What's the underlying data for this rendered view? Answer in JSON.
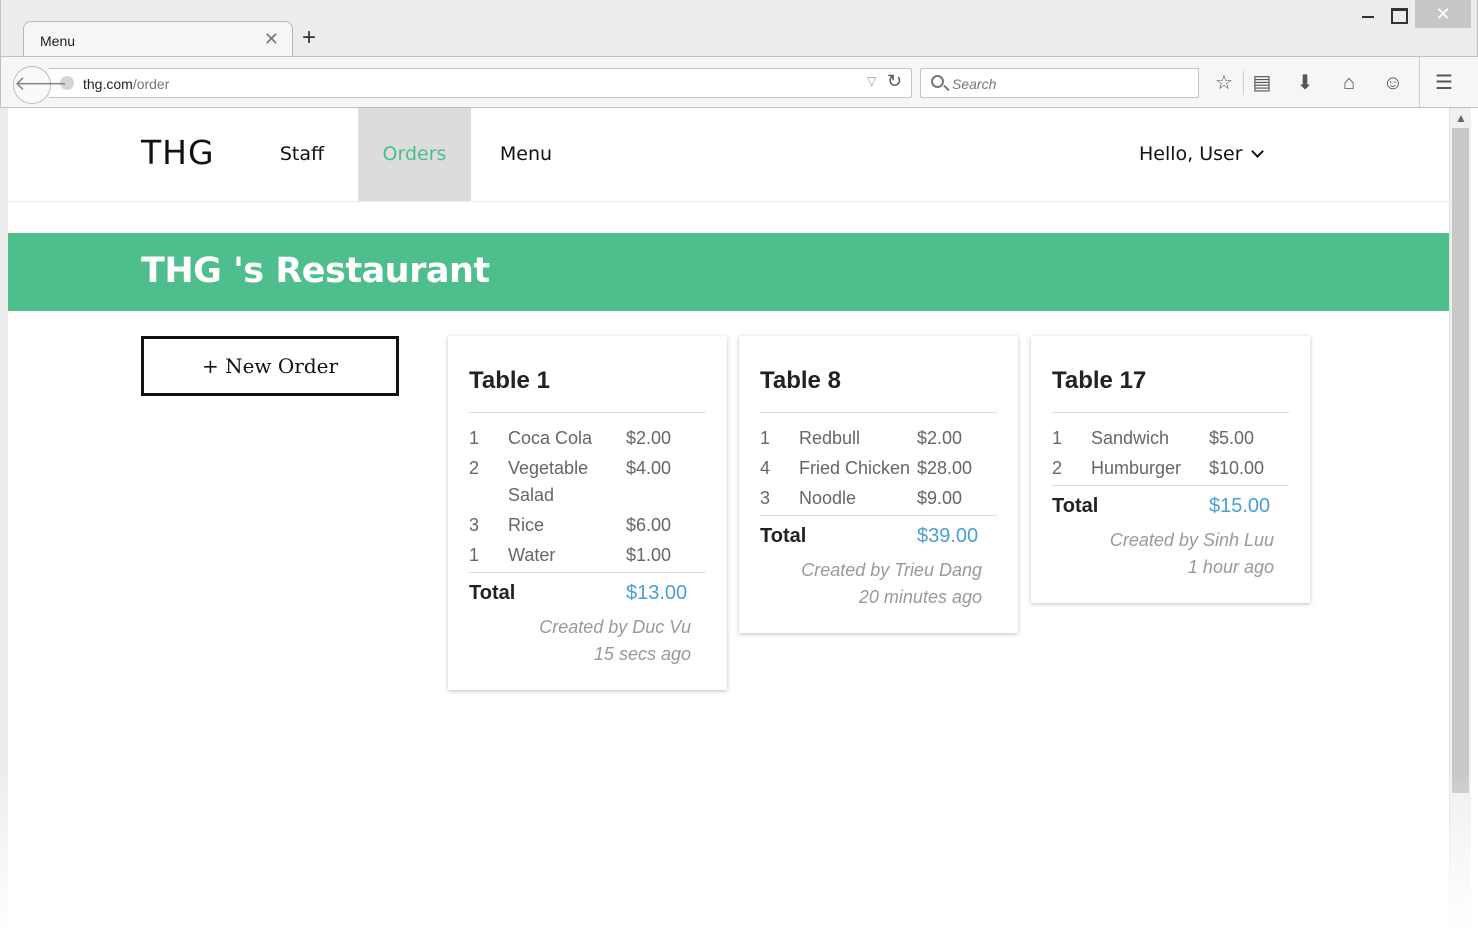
{
  "browser": {
    "tab_title": "Menu",
    "url_domain": "thg.com",
    "url_path": "/order",
    "search_placeholder": "Search"
  },
  "site": {
    "brand": "THG",
    "nav": {
      "staff": "Staff",
      "orders": "Orders",
      "menu": "Menu"
    },
    "user_greeting": "Hello, User",
    "banner_title": "THG 's Restaurant",
    "new_order_label": "+ New Order",
    "accent_color": "#4fbe8d",
    "price_color": "#4a9fd6"
  },
  "orders": [
    {
      "table": "Table 1",
      "items": [
        {
          "qty": "1",
          "name": "Coca Cola",
          "price": "$2.00"
        },
        {
          "qty": "2",
          "name": "Vegetable Salad",
          "price": "$4.00"
        },
        {
          "qty": "3",
          "name": "Rice",
          "price": "$6.00"
        },
        {
          "qty": "1",
          "name": "Water",
          "price": "$1.00"
        }
      ],
      "total_label": "Total",
      "total": "$13.00",
      "created_by": "Created by Duc Vu",
      "time_ago": "15 secs ago"
    },
    {
      "table": "Table 8",
      "items": [
        {
          "qty": "1",
          "name": "Redbull",
          "price": "$2.00"
        },
        {
          "qty": "4",
          "name": "Fried Chicken",
          "price": "$28.00"
        },
        {
          "qty": "3",
          "name": "Noodle",
          "price": "$9.00"
        }
      ],
      "total_label": "Total",
      "total": "$39.00",
      "created_by": "Created by Trieu Dang",
      "time_ago": "20 minutes ago"
    },
    {
      "table": "Table 17",
      "items": [
        {
          "qty": "1",
          "name": "Sandwich",
          "price": "$5.00"
        },
        {
          "qty": "2",
          "name": "Humburger",
          "price": "$10.00"
        }
      ],
      "total_label": "Total",
      "total": "$15.00",
      "created_by": "Created by Sinh Luu",
      "time_ago": "1 hour ago"
    }
  ]
}
